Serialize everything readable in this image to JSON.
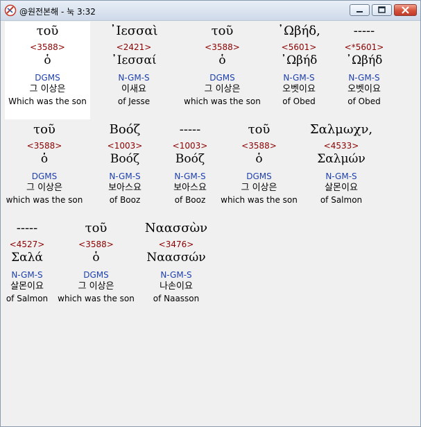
{
  "window": {
    "title": "@원전본해 - 눅 3:32"
  },
  "rows": [
    [
      {
        "greek": "τοῦ",
        "strong": "<3588>",
        "lemma": "ὁ",
        "morph": "DGMS",
        "korean": "그 이상은",
        "english": "Which was the son"
      },
      {
        "greek": "᾿Ιεσσαὶ",
        "strong": "<2421>",
        "lemma": "᾿Ιεσσαί",
        "morph": "N-GM-S",
        "korean": "이새요",
        "english": "of Jesse"
      },
      {
        "greek": "τοῦ",
        "strong": "<3588>",
        "lemma": "ὁ",
        "morph": "DGMS",
        "korean": "그 이상은",
        "english": "which was the son"
      },
      {
        "greek": "᾿Ωβήδ,",
        "strong": "<5601>",
        "lemma": "᾿Ωβήδ",
        "morph": "N-GM-S",
        "korean": "오벳이요",
        "english": "of Obed"
      },
      {
        "greek": "-----",
        "strong": "<*5601>",
        "lemma": "᾿Ωβήδ",
        "morph": "N-GM-S",
        "korean": "오벳이요",
        "english": "of Obed"
      }
    ],
    [
      {
        "greek": "τοῦ",
        "strong": "<3588>",
        "lemma": "ὁ",
        "morph": "DGMS",
        "korean": "그 이상은",
        "english": "which was the son"
      },
      {
        "greek": "Βοόζ",
        "strong": "<1003>",
        "lemma": "Βοόζ",
        "morph": "N-GM-S",
        "korean": "보아스요",
        "english": "of Booz"
      },
      {
        "greek": "-----",
        "strong": "<1003>",
        "lemma": "Βοόζ",
        "morph": "N-GM-S",
        "korean": "보아스요",
        "english": "of Booz"
      },
      {
        "greek": "τοῦ",
        "strong": "<3588>",
        "lemma": "ὁ",
        "morph": "DGMS",
        "korean": "그 이상은",
        "english": "which was the son"
      },
      {
        "greek": "Σαλμωχν,",
        "strong": "<4533>",
        "lemma": "Σαλμών",
        "morph": "N-GM-S",
        "korean": "살몬이요",
        "english": "of Salmon"
      }
    ],
    [
      {
        "greek": "-----",
        "strong": "<4527>",
        "lemma": "Σαλά",
        "morph": "N-GM-S",
        "korean": "살몬이요",
        "english": "of Salmon"
      },
      {
        "greek": "τοῦ",
        "strong": "<3588>",
        "lemma": "ὁ",
        "morph": "DGMS",
        "korean": "그 이상은",
        "english": "which was the son"
      },
      {
        "greek": "Ναασσὼν",
        "strong": "<3476>",
        "lemma": "Ναασσών",
        "morph": "N-GM-S",
        "korean": "나손이요",
        "english": "of Naasson"
      }
    ]
  ]
}
